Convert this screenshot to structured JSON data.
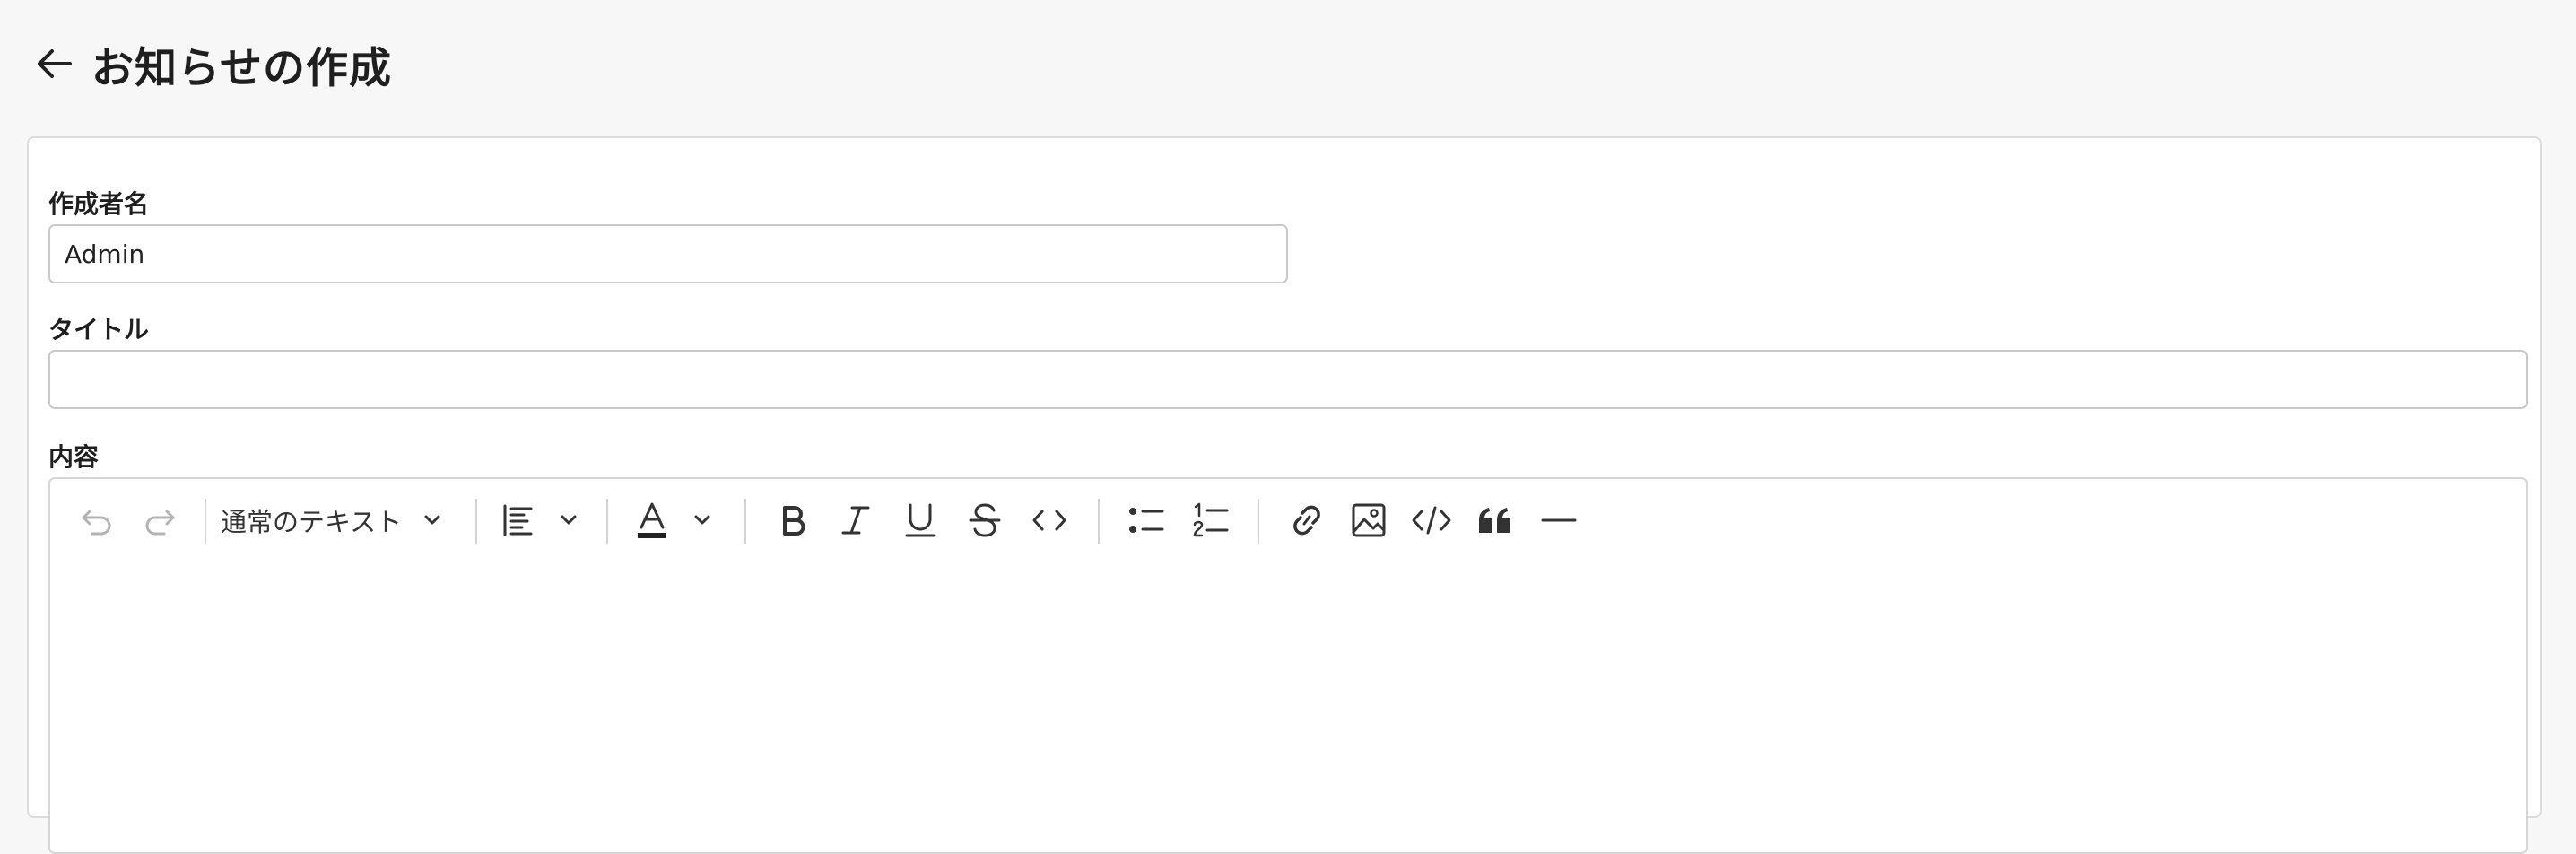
{
  "header": {
    "title": "お知らせの作成"
  },
  "form": {
    "author": {
      "label": "作成者名",
      "value": "Admin"
    },
    "title": {
      "label": "タイトル",
      "value": ""
    },
    "content": {
      "label": "内容"
    }
  },
  "editor": {
    "block_type": "通常のテキスト",
    "toolbar": [
      "undo-icon",
      "redo-icon",
      "chevron-down-icon",
      "align-left-icon",
      "text-color-icon",
      "bold-icon",
      "italic-icon",
      "underline-icon",
      "strikethrough-icon",
      "inline-code-icon",
      "bullet-list-icon",
      "numbered-list-icon",
      "link-icon",
      "image-icon",
      "code-block-icon",
      "quote-icon",
      "horizontal-rule-icon"
    ],
    "text_color": "#222222"
  }
}
